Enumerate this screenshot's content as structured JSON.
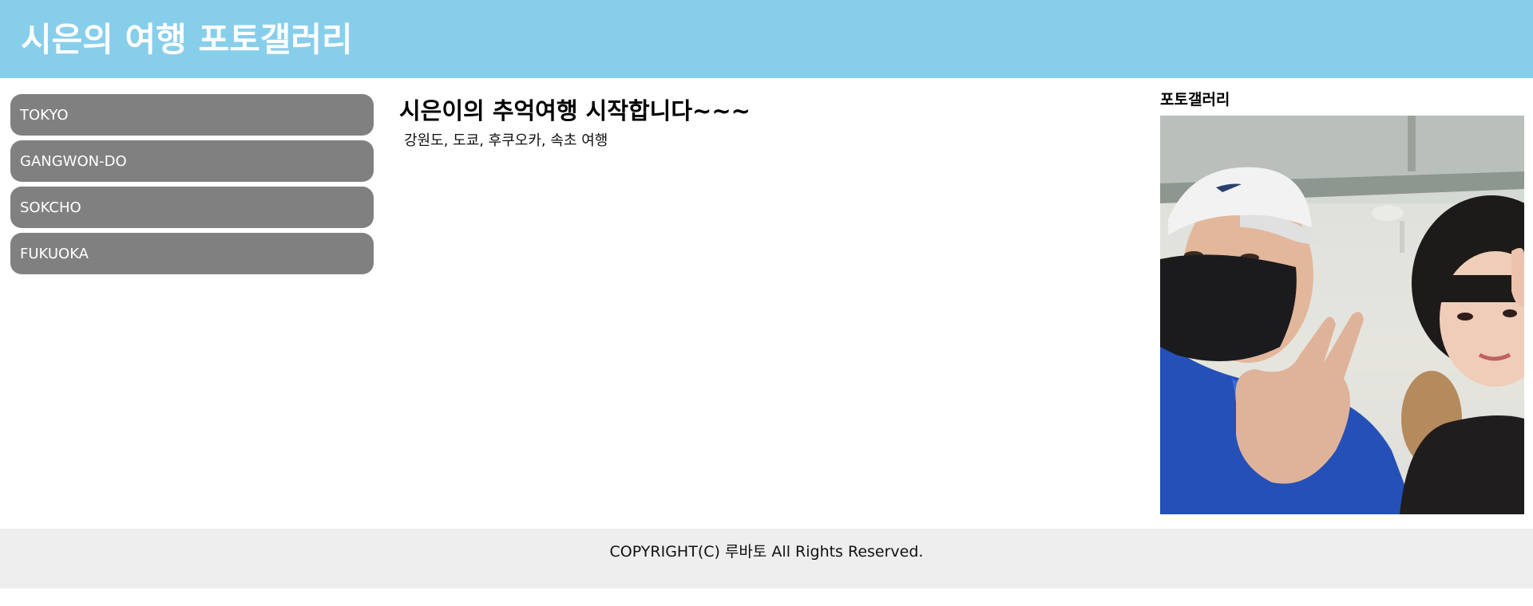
{
  "header": {
    "title": "시은의 여행 포토갤러리",
    "background_color": "#87CEEB"
  },
  "sidebar": {
    "items": [
      {
        "label": "TOKYO"
      },
      {
        "label": "GANGWON-DO"
      },
      {
        "label": "SOKCHO"
      },
      {
        "label": "FUKUOKA"
      }
    ],
    "item_color": "#808080"
  },
  "main": {
    "heading": "시은이의 추억여행 시작합니다~~~",
    "description": "강원도, 도쿄, 후쿠오카, 속초 여행"
  },
  "gallery": {
    "title": "포토갤러리",
    "photo": "photo of two people taking a selfie, one in a white cap and black mask making a V sign"
  },
  "footer": {
    "copyright": "COPYRIGHT(C) 루바토 All Rights Reserved.",
    "background_color": "#eeeeee"
  }
}
